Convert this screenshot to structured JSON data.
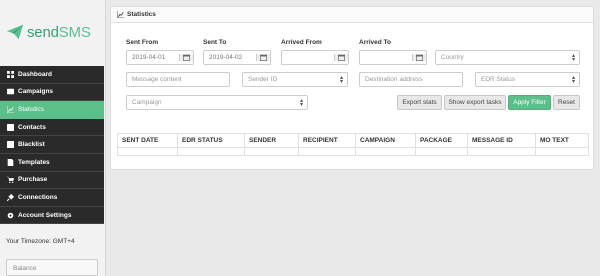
{
  "brand": {
    "name_part1": "send",
    "name_part2": "SMS",
    "color": "#3a9d73"
  },
  "sidebar": {
    "items": [
      {
        "label": "Dashboard",
        "icon": "dashboard-icon",
        "active": false
      },
      {
        "label": "Campaigns",
        "icon": "campaigns-icon",
        "active": false
      },
      {
        "label": "Statistics",
        "icon": "statistics-icon",
        "active": true
      },
      {
        "label": "Contacts",
        "icon": "contacts-icon",
        "active": false
      },
      {
        "label": "Blacklist",
        "icon": "blacklist-icon",
        "active": false
      },
      {
        "label": "Templates",
        "icon": "templates-icon",
        "active": false
      },
      {
        "label": "Purchase",
        "icon": "cart-icon",
        "active": false
      },
      {
        "label": "Connections",
        "icon": "plug-icon",
        "active": false
      },
      {
        "label": "Account Settings",
        "icon": "gear-icon",
        "active": false
      }
    ],
    "timezone": "Your Timezone: GMT+4",
    "balance_placeholder": "Balance"
  },
  "panel": {
    "title": "Statistics"
  },
  "filters": {
    "sent_from_label": "Sent From",
    "sent_from_value": "2019-04-01",
    "sent_to_label": "Sent To",
    "sent_to_value": "2019-04-02",
    "arrived_from_label": "Arrived From",
    "arrived_to_label": "Arrived To",
    "country_placeholder": "Country",
    "message_content_placeholder": "Message content",
    "sender_id_placeholder": "Sender ID",
    "destination_placeholder": "Destination address",
    "edr_status_placeholder": "EDR Status",
    "campaign_placeholder": "Campaign"
  },
  "buttons": {
    "export_stats": "Export stats",
    "show_export_tasks": "Show export tasks",
    "apply_filter": "Apply Filter",
    "reset": "Reset"
  },
  "table": {
    "columns": [
      "SENT DATE",
      "EDR STATUS",
      "SENDER",
      "RECIPIENT",
      "CAMPAIGN",
      "PACKAGE",
      "MESSAGE ID",
      "MO TEXT"
    ]
  },
  "colors": {
    "accent": "#5cbf8a",
    "sidebar_dark": "#2a2a2a"
  }
}
